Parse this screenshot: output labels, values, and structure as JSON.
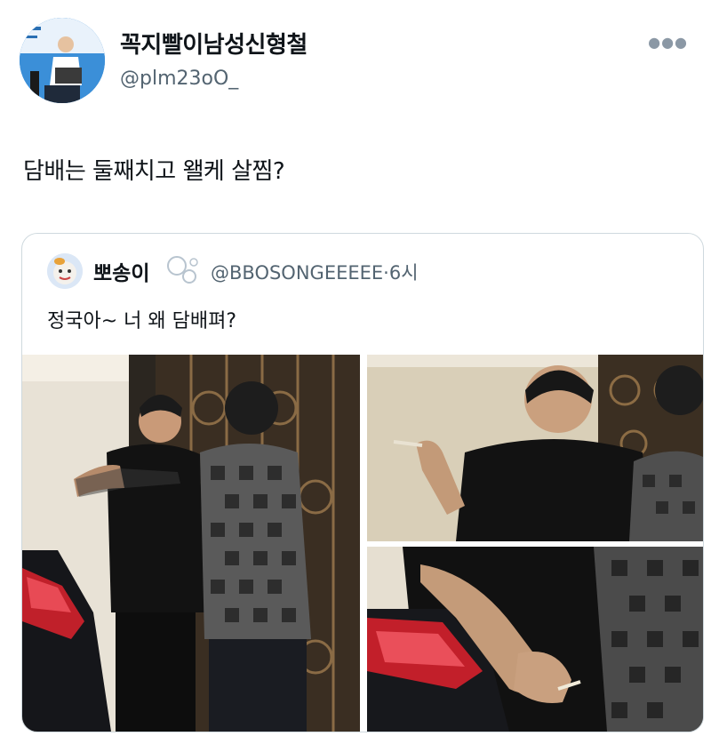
{
  "tweet": {
    "author_name": "꼭지빨이남성신형철",
    "author_handle": "@plm23oO_",
    "more_icon": "more-horizontal-icon",
    "text": "담배는 둘째치고 왤케 살찜?"
  },
  "quoted_tweet": {
    "author_name": "뽀송이",
    "author_handle": "@BBOSONGEEEEE",
    "separator": "·",
    "time": "6시",
    "text": "정국아~ 너 왜 담배펴?",
    "media": [
      {
        "alt": "photo-1",
        "description_icon": "photo"
      },
      {
        "alt": "photo-2",
        "description_icon": "photo"
      },
      {
        "alt": "photo-3",
        "description_icon": "photo"
      }
    ]
  }
}
